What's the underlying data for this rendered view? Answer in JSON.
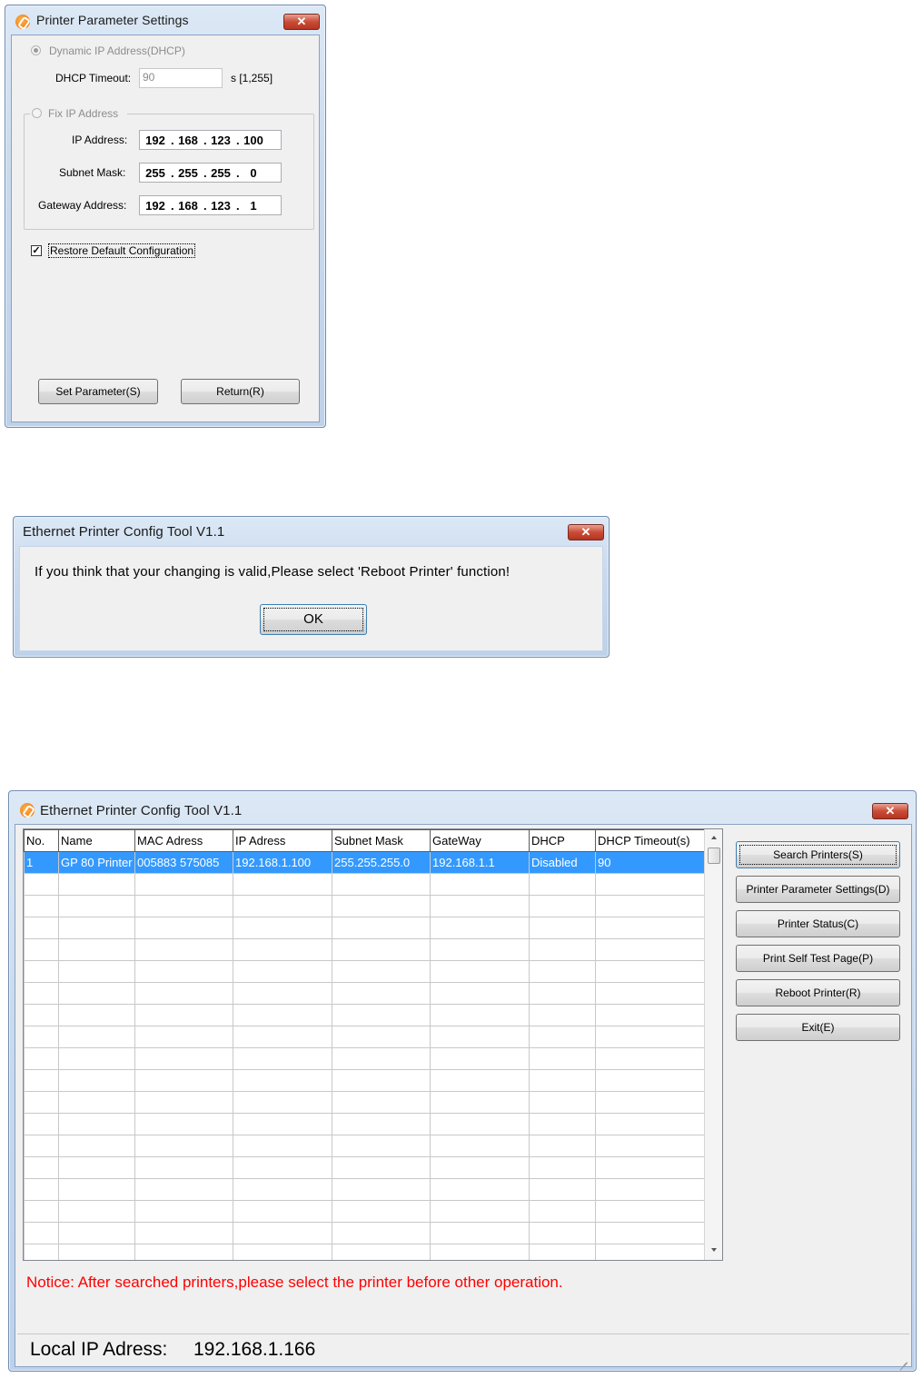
{
  "settings_dialog": {
    "title": "Printer Parameter Settings",
    "close_label": "✕",
    "dhcp_radio_label": "Dynamic IP Address(DHCP)",
    "dhcp_timeout_label": "DHCP Timeout:",
    "dhcp_timeout_value": "90",
    "dhcp_timeout_range": "s  [1,255]",
    "fix_ip_radio_label": "Fix IP Address",
    "ip_label": "IP Address:",
    "ip_value": [
      "192",
      "168",
      "123",
      "100"
    ],
    "subnet_label": "Subnet Mask:",
    "subnet_value": [
      "255",
      "255",
      "255",
      "0"
    ],
    "gateway_label": "Gateway Address:",
    "gateway_value": [
      "192",
      "168",
      "123",
      "1"
    ],
    "restore_label": "Restore Default Configuration",
    "restore_checked": true,
    "set_button": "Set Parameter(S)",
    "return_button": "Return(R)"
  },
  "message_box": {
    "title": "Ethernet Printer Config Tool V1.1",
    "close_label": "✕",
    "message": "If you think that your changing is valid,Please select 'Reboot Printer' function!",
    "ok_button": "OK"
  },
  "main_window": {
    "title": "Ethernet Printer Config Tool V1.1",
    "close_label": "✕",
    "columns": [
      "No.",
      "Name",
      "MAC Adress",
      "IP Adress",
      "Subnet Mask",
      "GateWay",
      "DHCP",
      "DHCP Timeout(s)"
    ],
    "rows": [
      [
        "1",
        "GP 80 Printer",
        "005883 575085",
        "192.168.1.100",
        "255.255.255.0",
        "192.168.1.1",
        "Disabled",
        "90"
      ]
    ],
    "buttons": {
      "search": "Search Printers(S)",
      "params": "Printer Parameter Settings(D)",
      "status": "Printer Status(C)",
      "selftest": "Print Self Test Page(P)",
      "reboot": "Reboot Printer(R)",
      "exit": "Exit(E)"
    },
    "notice": "Notice: After searched printers,please select the printer before other operation.",
    "status_label": "Local IP Adress:",
    "status_value": "192.168.1.166"
  },
  "colors": {
    "selection": "#3399ff",
    "notice": "#ff0000",
    "close_button": "#c94c36"
  }
}
